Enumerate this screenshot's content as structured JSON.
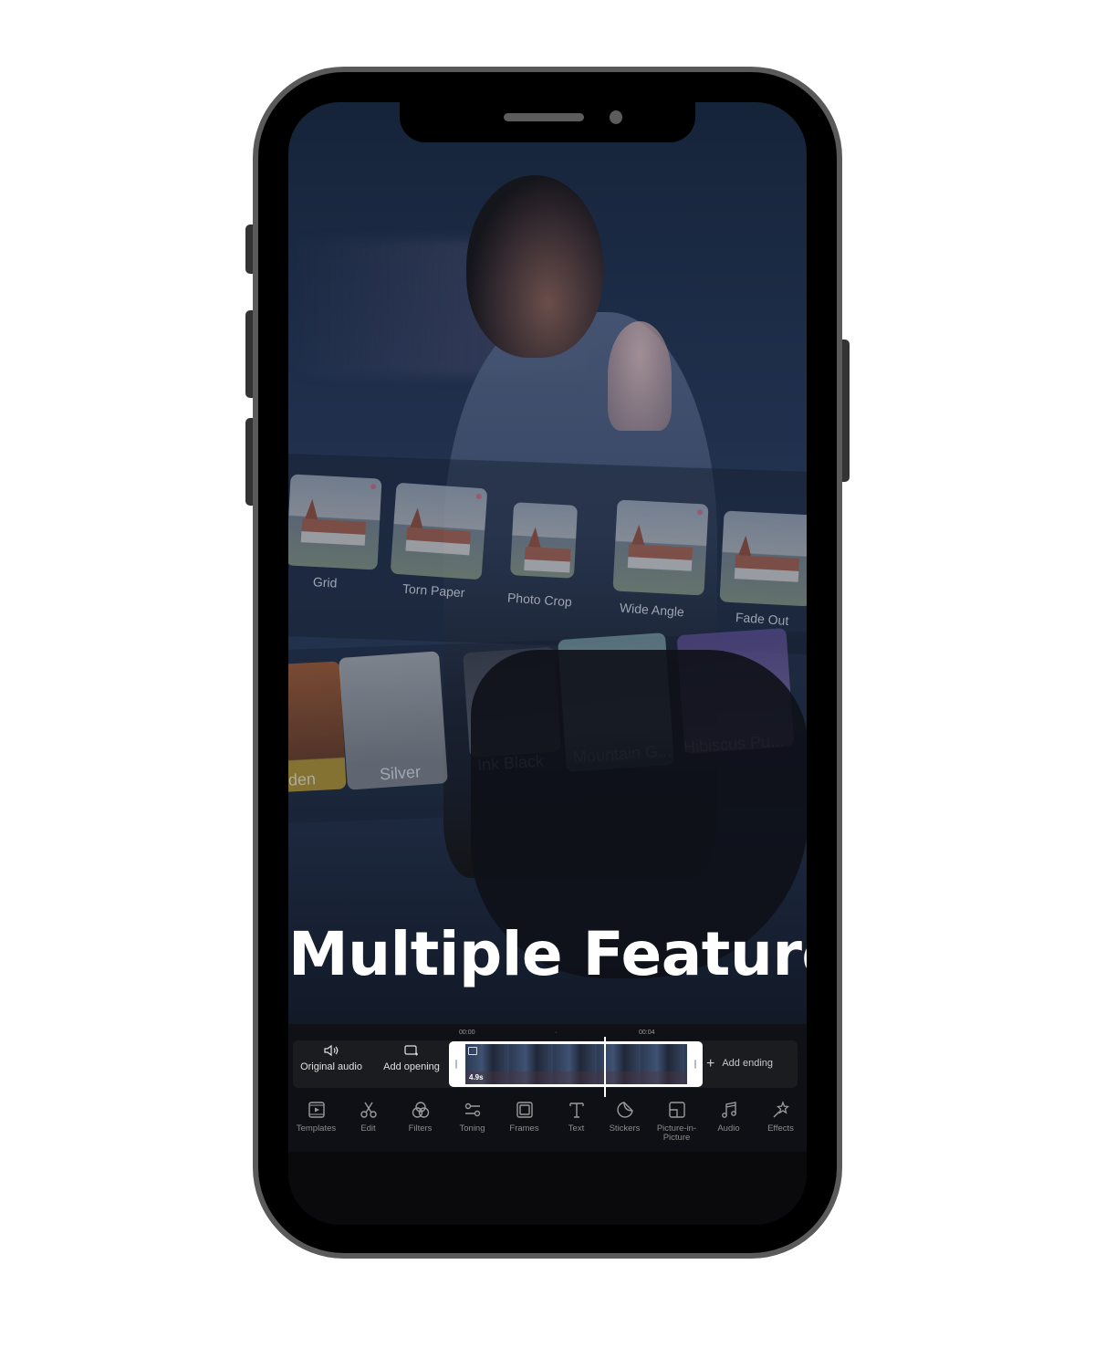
{
  "headline": "Multiple Features",
  "feature_cards": [
    {
      "label": "Grid"
    },
    {
      "label": "Torn Paper"
    },
    {
      "label": "Photo Crop"
    },
    {
      "label": "Wide Angle"
    },
    {
      "label": "Fade Out"
    }
  ],
  "filter_cards": [
    {
      "label": "den",
      "color": "#a0582e"
    },
    {
      "label": "Silver",
      "color": "#8a8e94"
    },
    {
      "label": "Ink Black",
      "color": "#3a3f4a"
    },
    {
      "label": "Mountain G...",
      "color": "#6f9098"
    },
    {
      "label": "Hibiscus Pu...",
      "color": "#55488a"
    }
  ],
  "editor": {
    "original_audio": "Original audio",
    "add_opening": "Add opening",
    "add_ending": "Add ending",
    "ruler": {
      "start": "00:00",
      "mark": "00:04"
    },
    "clip_duration": "4.9s"
  },
  "toolbar": [
    {
      "label": "Templates",
      "icon": "templates-icon"
    },
    {
      "label": "Edit",
      "icon": "scissors-icon"
    },
    {
      "label": "Filters",
      "icon": "filters-icon"
    },
    {
      "label": "Toning",
      "icon": "toning-icon"
    },
    {
      "label": "Frames",
      "icon": "frames-icon"
    },
    {
      "label": "Text",
      "icon": "text-icon"
    },
    {
      "label": "Stickers",
      "icon": "stickers-icon"
    },
    {
      "label": "Picture-in-Picture",
      "icon": "pip-icon"
    },
    {
      "label": "Audio",
      "icon": "music-icon"
    },
    {
      "label": "Effects",
      "icon": "effects-icon"
    }
  ]
}
